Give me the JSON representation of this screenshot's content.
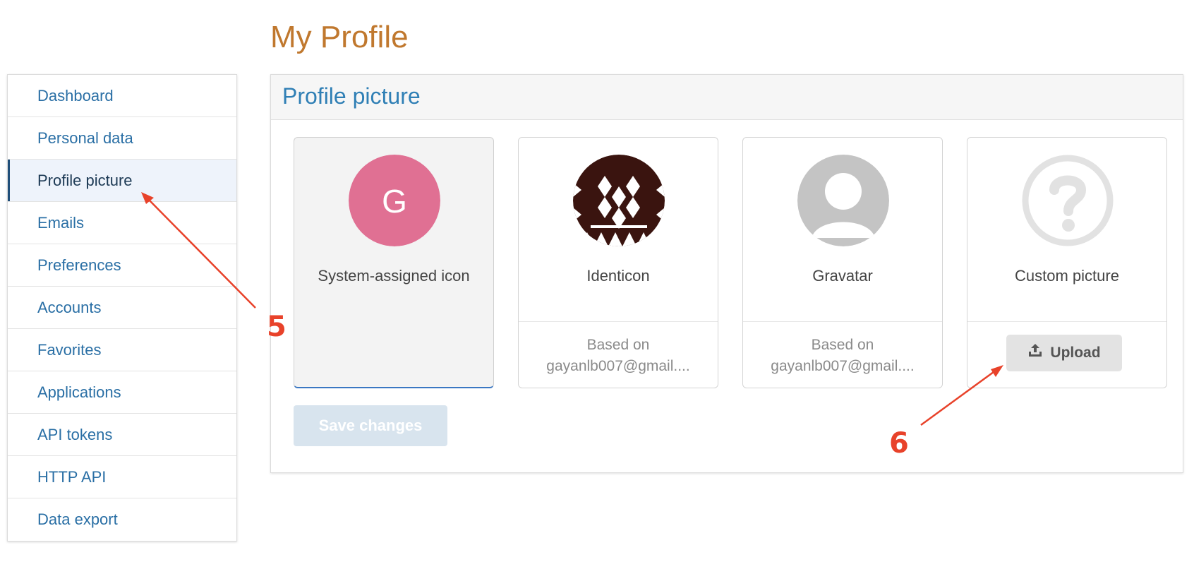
{
  "page": {
    "title": "My Profile"
  },
  "sidebar": {
    "items": [
      {
        "label": "Dashboard"
      },
      {
        "label": "Personal data"
      },
      {
        "label": "Profile picture",
        "active": true
      },
      {
        "label": "Emails"
      },
      {
        "label": "Preferences"
      },
      {
        "label": "Accounts"
      },
      {
        "label": "Favorites"
      },
      {
        "label": "Applications"
      },
      {
        "label": "API tokens"
      },
      {
        "label": "HTTP API"
      },
      {
        "label": "Data export"
      }
    ]
  },
  "panel": {
    "title": "Profile picture",
    "cards": [
      {
        "label": "System-assigned icon",
        "avatar_letter": "G",
        "avatar_color": "#e07093",
        "selected": true
      },
      {
        "label": "Identicon",
        "footer_line1": "Based on",
        "footer_line2": "gayanlb007@gmail...."
      },
      {
        "label": "Gravatar",
        "footer_line1": "Based on",
        "footer_line2": "gayanlb007@gmail...."
      },
      {
        "label": "Custom picture",
        "upload_label": "Upload"
      }
    ],
    "save_label": "Save changes"
  },
  "annotations": {
    "a5": "5",
    "a6": "6"
  },
  "colors": {
    "title": "#c0782e",
    "link": "#2a6fa5",
    "annotation": "#e8422a"
  }
}
